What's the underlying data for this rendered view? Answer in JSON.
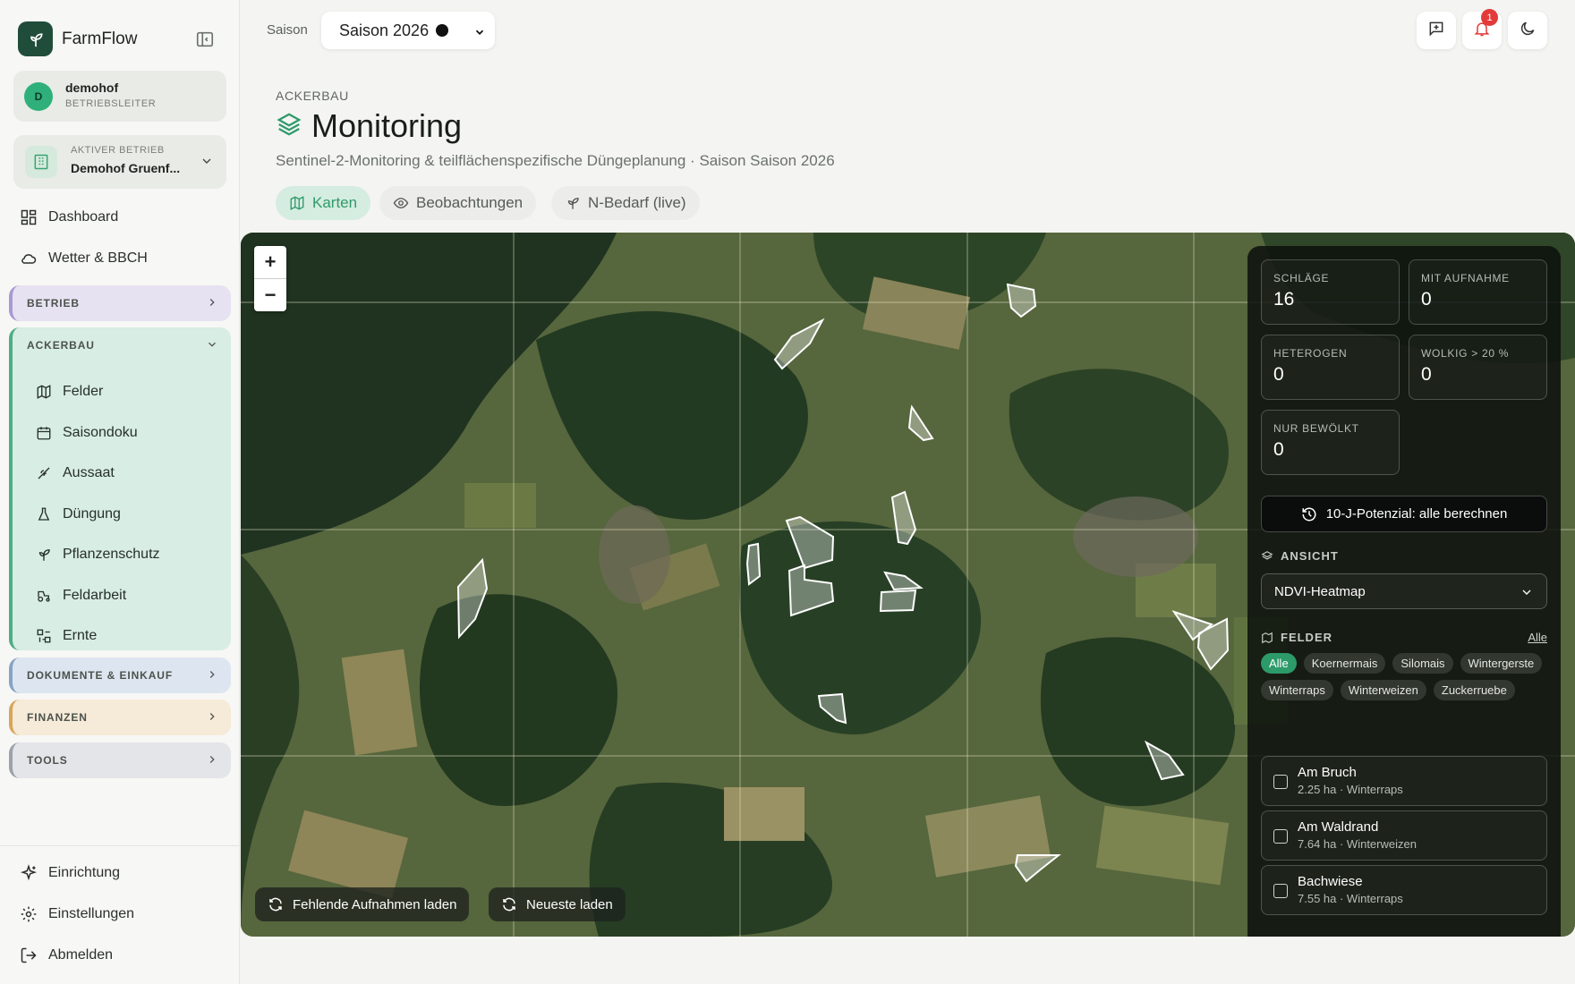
{
  "app": {
    "name": "FarmFlow"
  },
  "user": {
    "initial": "D",
    "name": "demohof",
    "role": "BETRIEBSLEITER"
  },
  "active_farm": {
    "label": "AKTIVER BETRIEB",
    "name": "Demohof Gruenf..."
  },
  "nav": {
    "dashboard": "Dashboard",
    "weather": "Wetter & BBCH",
    "sections": {
      "betrieb": "BETRIEB",
      "ackerbau": "ACKERBAU",
      "doku": "DOKUMENTE & EINKAUF",
      "finanzen": "FINANZEN",
      "tools": "TOOLS"
    },
    "ackerbau_items": [
      "Felder",
      "Saisondoku",
      "Aussaat",
      "Düngung",
      "Pflanzenschutz",
      "Feldarbeit",
      "Ernte"
    ],
    "bottom": [
      "Einrichtung",
      "Einstellungen",
      "Abmelden"
    ]
  },
  "topbar": {
    "season_label": "Saison",
    "season_value": "Saison 2026",
    "notification_count": "1"
  },
  "page": {
    "eyebrow": "ACKERBAU",
    "title": "Monitoring",
    "subtitle": "Sentinel-2-Monitoring & teilflächenspezifische Düngeplanung · Saison Saison 2026",
    "tabs": [
      "Karten",
      "Beobachtungen",
      "N-Bedarf (live)"
    ]
  },
  "map": {
    "zoom_in": "+",
    "zoom_out": "−",
    "btn_missing": "Fehlende Aufnahmen laden",
    "btn_latest": "Neueste laden"
  },
  "panel": {
    "stats": [
      {
        "label": "SCHLÄGE",
        "value": "16"
      },
      {
        "label": "MIT AUFNAHME",
        "value": "0"
      },
      {
        "label": "HETEROGEN",
        "value": "0"
      },
      {
        "label": "WOLKIG > 20 %",
        "value": "0"
      },
      {
        "label": "NUR BEWÖLKT",
        "value": "0"
      }
    ],
    "potential_button": "10-J-Potenzial: alle berechnen",
    "view_heading": "ANSICHT",
    "view_value": "NDVI-Heatmap",
    "fields_heading": "FELDER",
    "all_link": "Alle",
    "chips": [
      "Alle",
      "Koernermais",
      "Silomais",
      "Wintergerste",
      "Winterraps",
      "Winterweizen",
      "Zuckerruebe"
    ],
    "fields": [
      {
        "name": "Am Bruch",
        "meta": "2.25 ha · Winterraps"
      },
      {
        "name": "Am Waldrand",
        "meta": "7.64 ha · Winterweizen"
      },
      {
        "name": "Bachwiese",
        "meta": "7.55 ha · Winterraps"
      }
    ]
  },
  "colors": {
    "accent": "#2d9a6a",
    "brand": "#1f4d3a",
    "badge": "#e33a3a"
  }
}
